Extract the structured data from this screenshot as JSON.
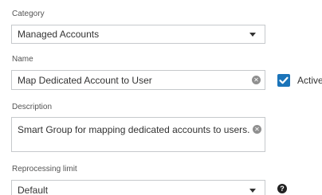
{
  "category": {
    "label": "Category",
    "value": "Managed Accounts",
    "icon": "chevron-down-icon"
  },
  "name": {
    "label": "Name",
    "value": "Map Dedicated Account to User",
    "clear_icon": "clear-icon",
    "active": {
      "label": "Active",
      "checked": true
    }
  },
  "description": {
    "label": "Description",
    "value": "Smart Group for mapping dedicated accounts to users.",
    "clear_icon": "clear-icon"
  },
  "reprocessing": {
    "label": "Reprocessing limit",
    "value": "Default",
    "icon": "chevron-down-icon",
    "help_icon": "question-circle-icon"
  },
  "colors": {
    "accent": "#1b74b9",
    "border": "#c6c9cc",
    "text": "#333333"
  }
}
